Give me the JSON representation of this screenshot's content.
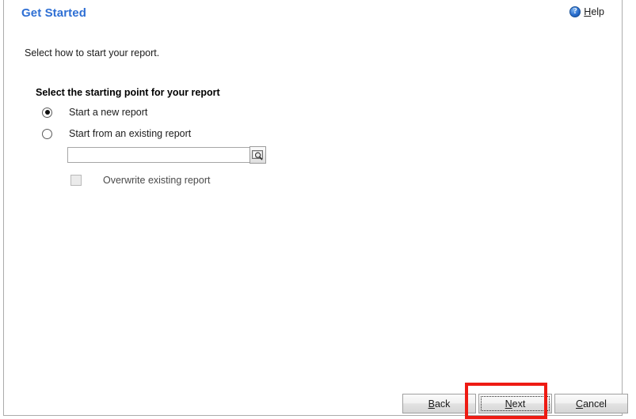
{
  "header": {
    "title": "Get Started",
    "help": {
      "label": "Help",
      "accesskey": "H",
      "rest": "elp",
      "icon": "help-question-icon",
      "glyph": "?"
    }
  },
  "body": {
    "instruction": "Select how to start your report.",
    "group_heading": "Select the starting point for your report",
    "options": [
      {
        "label": "Start a new report",
        "selected": true
      },
      {
        "label": "Start from an existing report",
        "selected": false
      }
    ],
    "path_field": {
      "value": "",
      "placeholder": ""
    },
    "browse_button": {
      "icon": "magnifier-browse-icon",
      "tooltip": ""
    },
    "overwrite_checkbox": {
      "label": "Overwrite existing report",
      "checked": false,
      "enabled": false
    }
  },
  "footer": {
    "buttons": [
      {
        "label": "Back",
        "accesskey": "B",
        "rest": "ack",
        "focused": false,
        "highlighted": false
      },
      {
        "label": "Next",
        "accesskey": "N",
        "rest": "ext",
        "focused": true,
        "highlighted": true
      },
      {
        "label": "Cancel",
        "accesskey": "C",
        "rest": "ancel",
        "focused": false,
        "highlighted": false
      }
    ]
  },
  "annotation": {
    "target": "Next",
    "color": "#ee1b13"
  }
}
